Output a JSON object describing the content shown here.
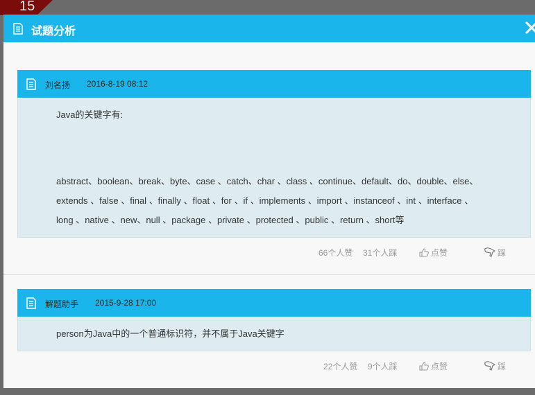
{
  "backdrop": {
    "badge_number": "15"
  },
  "dialog": {
    "title": "试题分析",
    "close_icon": "close-icon"
  },
  "answers": [
    {
      "author": "刘名扬",
      "date": "2016-8-19 08:12",
      "paragraphs": [
        "Java的关键字有:",
        "",
        "",
        "abstract、boolean、break、byte、case 、catch、char 、class 、continue、default、do、double、else、",
        "extends 、false 、final 、finally 、float 、for 、if 、implements 、import 、instanceof 、int 、interface 、",
        "long 、native 、new、null 、package 、private 、protected 、public 、return 、short等"
      ],
      "likes": "66个人赞",
      "dislikes": "31个人踩",
      "like_label": "点赞",
      "dislike_label": "踩"
    },
    {
      "author": "解题助手",
      "date": "2015-9-28 17:00",
      "paragraphs": [
        "person为Java中的一个普通标识符，并不属于Java关键字"
      ],
      "likes": "22个人赞",
      "dislikes": "9个人踩",
      "like_label": "点赞",
      "dislike_label": "踩"
    }
  ],
  "colors": {
    "header_blue": "#1ab5ea",
    "body_bg": "#deecf2",
    "backdrop": "#6b6b6b",
    "badge": "#7a0c0c"
  }
}
